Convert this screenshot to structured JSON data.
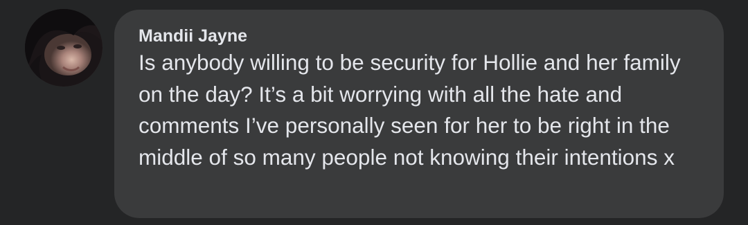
{
  "comment": {
    "author": "Mandii Jayne",
    "text": "Is anybody willing to be security for Hollie and her family on the day? It’s a bit worrying with all the hate and comments I’ve personally seen for her to be right in the middle of so many people not knowing their intentions x"
  },
  "colors": {
    "background": "#242526",
    "bubble": "#3a3b3c",
    "text": "#e4e6eb"
  }
}
